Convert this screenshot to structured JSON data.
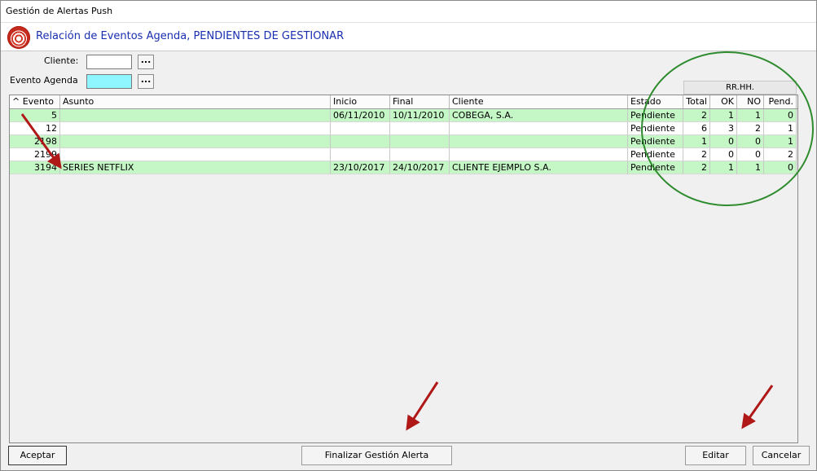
{
  "window": {
    "title": "Gestión de Alertas Push"
  },
  "header": {
    "title": "Relación de Eventos Agenda, PENDIENTES DE GESTIONAR",
    "icon": "alert-push-icon"
  },
  "filters": {
    "cliente_label": "Cliente:",
    "cliente_value": "",
    "evento_label": "Evento Agenda",
    "evento_value": "",
    "lookup_label": "..."
  },
  "grid": {
    "group_header": "RR.HH.",
    "columns": {
      "evento": "^ Evento",
      "asunto": "Asunto",
      "inicio": "Inicio",
      "final": "Final",
      "cliente": "Cliente",
      "estado": "Estado",
      "total": "Total",
      "ok": "OK",
      "no": "NO",
      "pend": "Pend."
    },
    "rows": [
      {
        "evento": "5",
        "asunto": "",
        "inicio": "06/11/2010",
        "final": "10/11/2010",
        "cliente": "COBEGA, S.A.",
        "estado": "Pendiente",
        "total": "2",
        "ok": "1",
        "no": "1",
        "pend": "0"
      },
      {
        "evento": "12",
        "asunto": "",
        "inicio": "",
        "final": "",
        "cliente": "",
        "estado": "Pendiente",
        "total": "6",
        "ok": "3",
        "no": "2",
        "pend": "1"
      },
      {
        "evento": "2198",
        "asunto": "",
        "inicio": "",
        "final": "",
        "cliente": "",
        "estado": "Pendiente",
        "total": "1",
        "ok": "0",
        "no": "0",
        "pend": "1"
      },
      {
        "evento": "2199",
        "asunto": "",
        "inicio": "",
        "final": "",
        "cliente": "",
        "estado": "Pendiente",
        "total": "2",
        "ok": "0",
        "no": "0",
        "pend": "2"
      },
      {
        "evento": "3194",
        "asunto": "SERIES NETFLIX",
        "inicio": "23/10/2017",
        "final": "24/10/2017",
        "cliente": "CLIENTE EJEMPLO S.A.",
        "estado": "Pendiente",
        "total": "2",
        "ok": "1",
        "no": "1",
        "pend": "0"
      }
    ]
  },
  "buttons": {
    "aceptar": "Aceptar",
    "finalizar": "Finalizar Gestión Alerta",
    "editar": "Editar",
    "cancelar": "Cancelar"
  },
  "colors": {
    "row_green": "#c5f7c6",
    "field_cyan": "#8ff5ff",
    "header_title": "#1a2fb0",
    "annotation_arrow": "#b01818",
    "annotation_circle": "#2e8b2e"
  }
}
